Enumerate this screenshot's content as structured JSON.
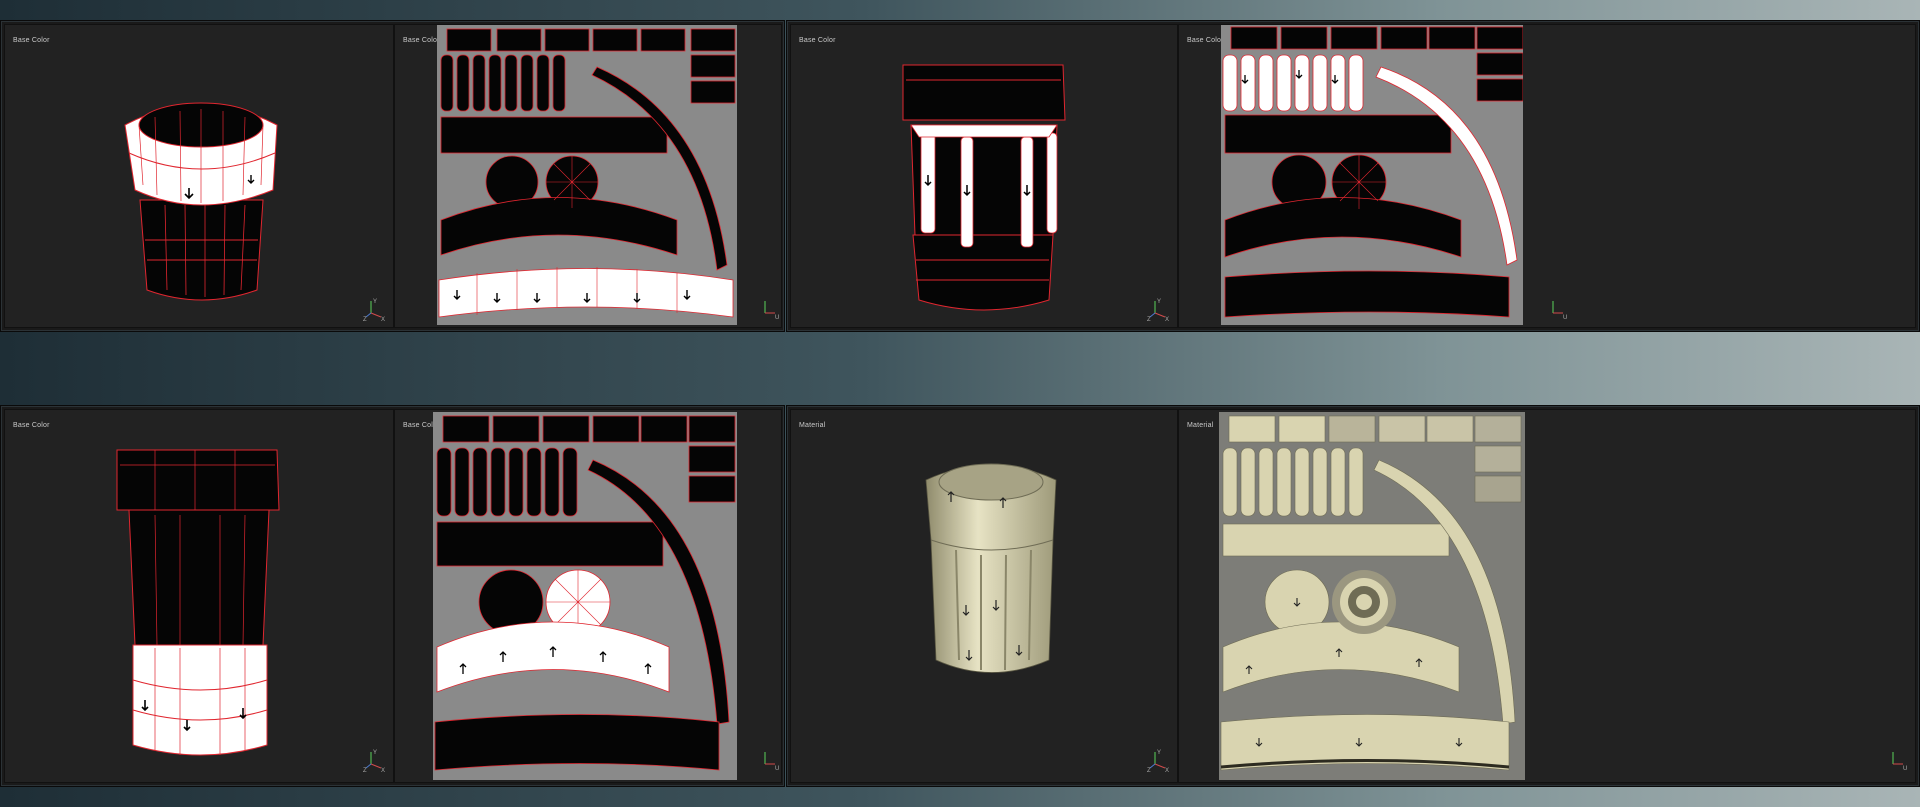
{
  "viewports": [
    {
      "id": "tl-3d",
      "label": "Base Color"
    },
    {
      "id": "tl-uv",
      "label": "Base Color"
    },
    {
      "id": "tr-3d",
      "label": "Base Color"
    },
    {
      "id": "tr-uv",
      "label": "Base Color"
    },
    {
      "id": "bl-3d",
      "label": "Base Color"
    },
    {
      "id": "bl-uv",
      "label": "Base Color"
    },
    {
      "id": "br-3d",
      "label": "Material"
    },
    {
      "id": "br-uv",
      "label": "Material"
    }
  ],
  "axis_labels": {
    "x": "X",
    "y": "Y",
    "z": "Z",
    "u": "U",
    "v": "V"
  },
  "colors": {
    "wire": "#e0262f",
    "selected": "#ffffff",
    "mesh": "#050505",
    "uv_bg": "#8a8a8a",
    "viewport_bg": "#222222",
    "material": "#d9d4b0"
  }
}
